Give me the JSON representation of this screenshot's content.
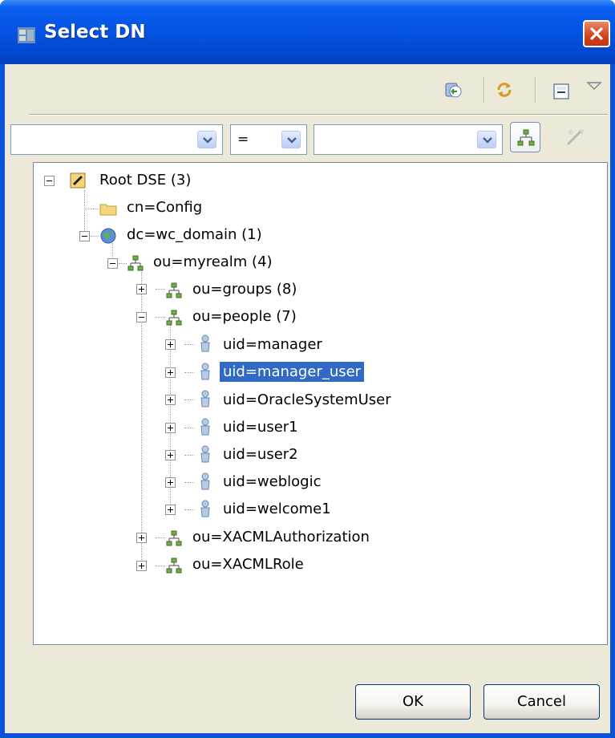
{
  "window": {
    "title": "Select DN"
  },
  "toolbar": {
    "icons": [
      "back-navigate-icon",
      "refresh-icon",
      "collapse-all-icon",
      "view-menu-icon"
    ]
  },
  "filter": {
    "attribute_value": "",
    "operator_value": "=",
    "value_value": ""
  },
  "tree": {
    "root": "Root DSE (3)",
    "config": "cn=Config",
    "domain": "dc=wc_domain (1)",
    "realm": "ou=myrealm (4)",
    "groups": "ou=groups (8)",
    "people": "ou=people (7)",
    "users": [
      "uid=manager",
      "uid=manager_user",
      "uid=OracleSystemUser",
      "uid=user1",
      "uid=user2",
      "uid=weblogic",
      "uid=welcome1"
    ],
    "selected": "uid=manager_user",
    "xacml_auth": "ou=XACMLAuthorization",
    "xacml_role": "ou=XACMLRole"
  },
  "buttons": {
    "ok": "OK",
    "cancel": "Cancel"
  },
  "colors": {
    "titlebar": "#0553e2",
    "selection": "#316ac5",
    "dialog_bg": "#ece9d8"
  }
}
